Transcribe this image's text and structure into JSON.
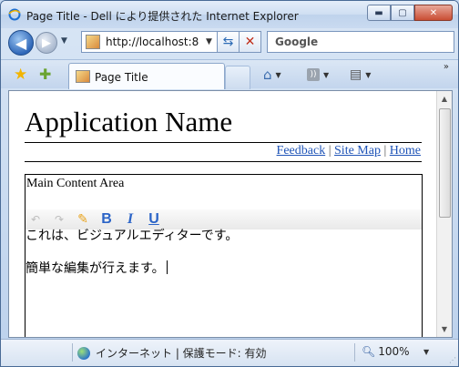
{
  "window": {
    "title": "Page Title - Dell により提供された Internet Explorer"
  },
  "nav": {
    "address": "http://localhost:8",
    "search_placeholder": "Google"
  },
  "tab": {
    "label": "Page Title"
  },
  "page": {
    "app_title": "Application Name",
    "links": [
      "Feedback",
      "Site Map",
      "Home"
    ],
    "separator": "|",
    "content_label": "Main Content Area",
    "editor_lines": [
      "これは、ビジュアルエディターです。",
      "簡単な編集が行えます。"
    ]
  },
  "status": {
    "zone": "インターネット | 保護モード: 有効",
    "zoom": "100%"
  },
  "colors": {
    "link": "#1f54b7",
    "toolbar_icon": "#2b64c7",
    "close_button": "#c94d33"
  },
  "icons": {
    "browser": "ie-icon",
    "back": "back-arrow-icon",
    "forward": "forward-arrow-icon",
    "refresh": "refresh-icon",
    "stop": "stop-icon",
    "favorites": "star-icon",
    "add_favorite": "add-favorite-icon",
    "home": "home-icon",
    "feeds": "feed-icon",
    "print": "print-icon",
    "undo": "undo-icon",
    "redo": "redo-icon",
    "edit": "edit-icon",
    "bold": "bold-icon",
    "italic": "italic-icon",
    "underline": "underline-icon",
    "internet_zone": "globe-icon",
    "zoom": "magnifier-icon"
  }
}
